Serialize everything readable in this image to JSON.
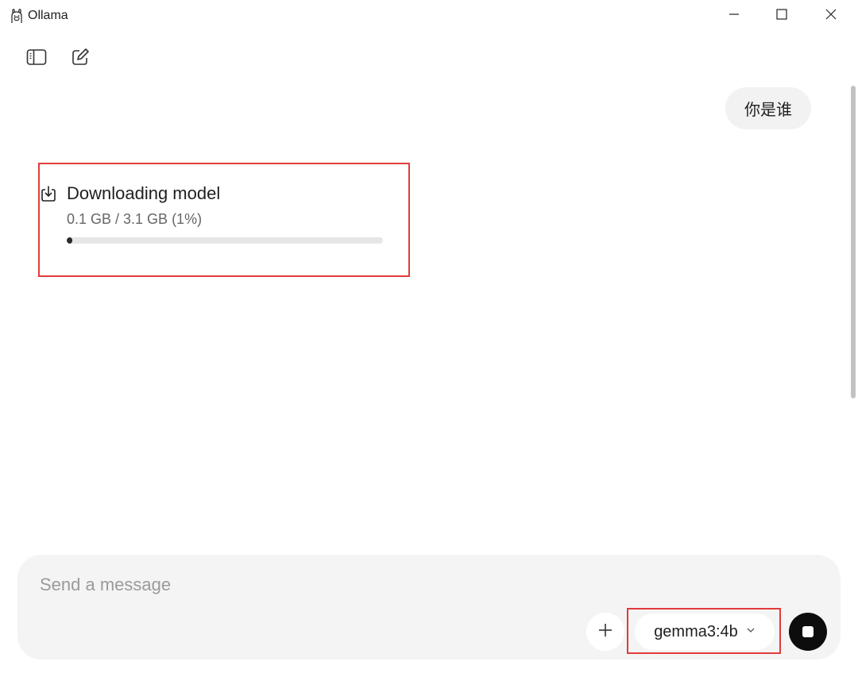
{
  "window": {
    "title": "Ollama",
    "icons": {
      "app": "ollama-llama-icon",
      "minimize": "minimize-icon",
      "maximize": "maximize-icon",
      "close": "close-icon"
    }
  },
  "toolbar": {
    "icons": [
      "sidebar-toggle-icon",
      "new-chat-icon"
    ]
  },
  "chat": {
    "user_message": "你是谁",
    "download": {
      "icon": "download-icon",
      "title": "Downloading model",
      "progress_text": "0.1 GB / 3.1 GB (1%)",
      "progress_fraction": 0.01
    }
  },
  "composer": {
    "placeholder": "Send a message",
    "value": "",
    "attach_icon": "plus-icon",
    "model": {
      "selected": "gemma3:4b",
      "icon": "chevron-down-icon"
    },
    "stop_icon": "stop-icon"
  },
  "colors": {
    "highlight": "#e23b3b",
    "bubble_bg": "#f2f2f2",
    "composer_bg": "#f4f4f4",
    "stop_bg": "#0d0d0d",
    "progress_fill": "#2a2a2a",
    "progress_track": "#e6e6e6"
  }
}
